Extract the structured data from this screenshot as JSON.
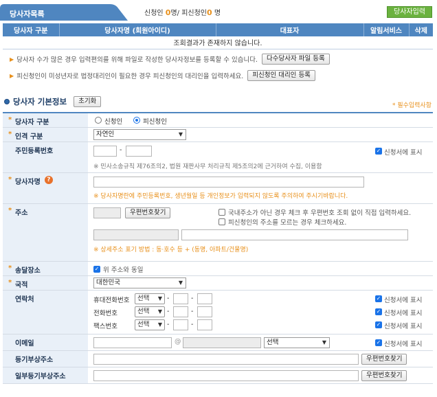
{
  "tab": {
    "label": "당사자목록"
  },
  "summary": {
    "prefix": "신청인",
    "applicant_count": "0",
    "middle": "명/ 피신청인",
    "respondent_count": "0",
    "suffix": "명"
  },
  "add_party_button": "당사자입력",
  "table": {
    "headers": [
      "당사자 구분",
      "당사자명 (회원아이디)",
      "대표자",
      "알림서비스",
      "삭제"
    ],
    "empty_message": "조회결과가 존재하지 않습니다."
  },
  "notes": [
    {
      "text": "당사자 수가 많은 경우 입력편의를 위해 파일로 작성한 당사자정보를 등록할 수 있습니다.",
      "button": "다수당사자 파일 등록"
    },
    {
      "text": "피신청인이 미성년자로 법정대리인이 필요한 경우 피신청인의 대리인을 입력하세요.",
      "button": "피신청인 대리인 등록"
    }
  ],
  "section": {
    "title": "당사자 기본정보",
    "reset_button": "초기화",
    "required_note": "* 필수입력사항"
  },
  "form": {
    "party_type": {
      "label": "당사자 구분",
      "options": [
        "신청인",
        "피신청인"
      ],
      "selected": "피신청인"
    },
    "person_type": {
      "label": "인격 구분",
      "value": "자연인"
    },
    "rrn": {
      "label": "주민등록번호",
      "dash": "-",
      "check_label": "신청서에 표시",
      "hint": "※ 민사소송규칙 제76조의2, 법원 재판사무 처리규칙 제5조의2에 근거하여 수집, 이용함"
    },
    "name": {
      "label": "당사자명",
      "help": "?",
      "warning": "※ 당사자명란에 주민등록번호, 생년월일 등 개인정보가 입력되지 않도록 주의하여 주시기바랍니다."
    },
    "address": {
      "label": "주소",
      "zip_button": "우편번호찾기",
      "check1": "국내주소가 아닌 경우 체크 후 우편번호 조회 없이 직접 입력하세요.",
      "check2": "피신청인의 주소를 모르는 경우 체크하세요.",
      "hint": "※ 상세주소 표기 방법 : 동·호수 등 + (동명, 아파트/건물명)"
    },
    "delivery": {
      "label": "송달장소",
      "check_label": "위 주소와 동일"
    },
    "nationality": {
      "label": "국적",
      "value": "대한민국"
    },
    "contact": {
      "label": "연락처",
      "rows": [
        {
          "label": "휴대전화번호",
          "select": "선택",
          "check_label": "신청서에 표시"
        },
        {
          "label": "전화번호",
          "select": "선택",
          "check_label": "신청서에 표시"
        },
        {
          "label": "팩스번호",
          "select": "선택",
          "check_label": "신청서에 표시"
        }
      ],
      "dash": "-"
    },
    "email": {
      "label": "이메일",
      "at": "@",
      "select": "선택",
      "check_label": "신청서에 표시"
    },
    "registry_address": {
      "label": "등기부상주소",
      "button": "우편번호찾기"
    },
    "partial_registry_address": {
      "label": "일부등기부상주소",
      "button": "우편번호찾기"
    }
  },
  "colors": {
    "header_blue": "#4f86c0",
    "label_bg": "#e9f0f8",
    "accent_orange": "#e8901b",
    "button_green": "#6bb23f",
    "checkbox_blue": "#1a73e8"
  }
}
